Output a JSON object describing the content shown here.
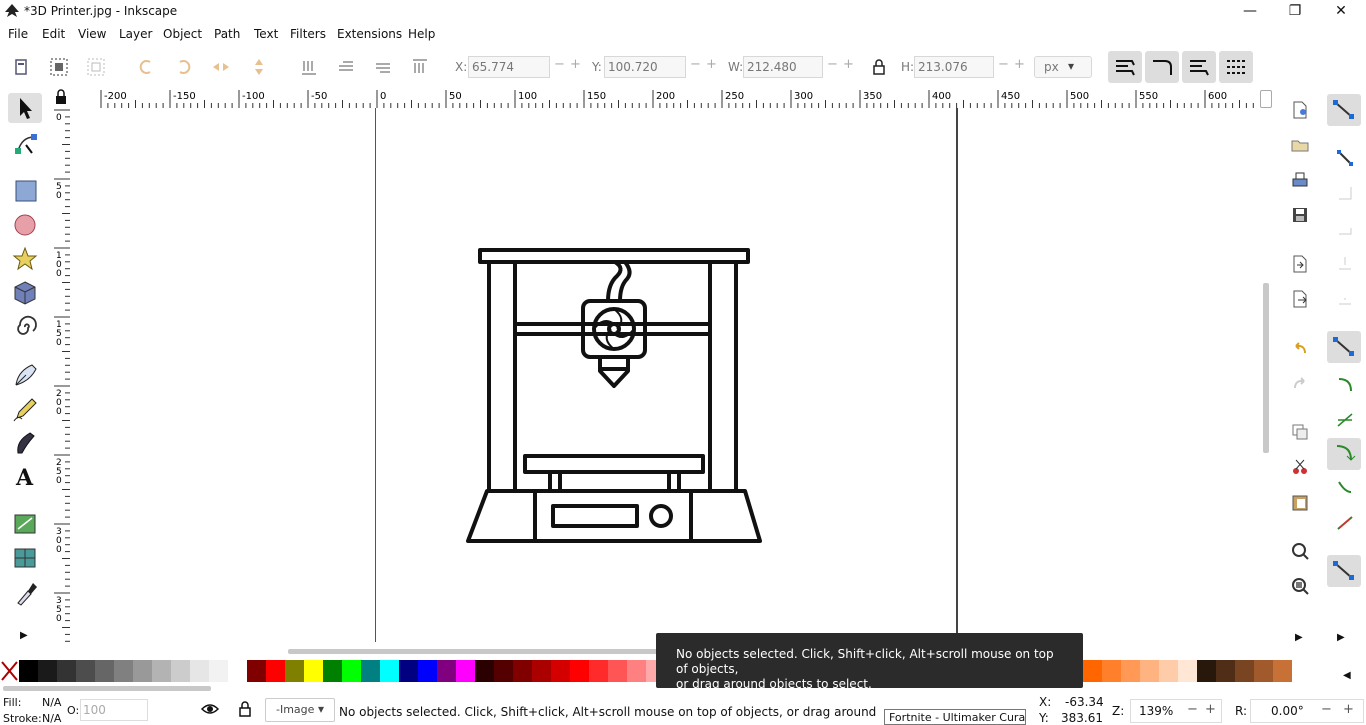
{
  "window": {
    "title": "*3D Printer.jpg - Inkscape",
    "minimize": "—",
    "maximize": "❐",
    "close": "✕"
  },
  "menu": [
    "File",
    "Edit",
    "View",
    "Layer",
    "Object",
    "Path",
    "Text",
    "Filters",
    "Extensions",
    "Help"
  ],
  "toolbar": {
    "x_label": "X:",
    "x_value": "65.774",
    "y_label": "Y:",
    "y_value": "100.720",
    "w_label": "W:",
    "w_value": "212.480",
    "h_label": "H:",
    "h_value": "213.076",
    "unit": "px"
  },
  "ruler": {
    "h_labels": [
      "-200",
      "-150",
      "-100",
      "-50",
      "0",
      "50",
      "100",
      "150",
      "200",
      "250",
      "300",
      "350",
      "400",
      "450",
      "500",
      "550",
      "600"
    ],
    "v_labels": [
      "0",
      "50",
      "100",
      "150",
      "200",
      "250",
      "300",
      "350"
    ]
  },
  "status": {
    "fill_label": "Fill:",
    "fill_value": "N/A",
    "stroke_label": "Stroke:",
    "stroke_value": "N/A",
    "opacity_label": "O:",
    "opacity_value": "100",
    "layer": "-Image",
    "message": "No objects selected. Click, Shift+click, Alt+scroll mouse on top of objects, or drag around objects to select.",
    "x_label": "X:",
    "x_value": "-63.34",
    "y_label": "Y:",
    "y_value": "383.61",
    "z_label": "Z:",
    "zoom": "139%",
    "r_label": "R:",
    "rotation": "0.00°"
  },
  "tooltip": {
    "line1": "No objects selected. Click, Shift+click, Alt+scroll mouse on top of objects,",
    "line2": "or drag around objects to select."
  },
  "taskbar_tooltip": "Fortnite - Ultimaker Cura",
  "palette": [
    "#000000",
    "#1a1a1a",
    "#333333",
    "#4d4d4d",
    "#666666",
    "#808080",
    "#999999",
    "#b3b3b3",
    "#cccccc",
    "#e6e6e6",
    "#f2f2f2",
    "#ffffff",
    "#800000",
    "#ff0000",
    "#808000",
    "#ffff00",
    "#008000",
    "#00ff00",
    "#008080",
    "#00ffff",
    "#000080",
    "#0000ff",
    "#800080",
    "#ff00ff",
    "#2b0000",
    "#550000",
    "#800000",
    "#aa0000",
    "#d40000",
    "#ff0000",
    "#ff2a2a",
    "#ff5555",
    "#ff8080",
    "#ffaaaa",
    "#ffd5d5",
    "#280b0b",
    "#501616",
    "#782121",
    "#a02c2c",
    "#c83737",
    "#d35f5f",
    "#de8787",
    "#e9afaf",
    "#f4d7d7",
    "#241c1c",
    "#483737",
    "#6c5353",
    "#917c6f",
    "#b7a59c",
    "#d3c5bc",
    "#e9ddd6",
    "#2b1100",
    "#552200",
    "#803300",
    "#aa4400",
    "#d45500",
    "#ff6600",
    "#ff7f2a",
    "#ff9955",
    "#ffb380",
    "#ffccaa",
    "#ffe6d5",
    "#28170b",
    "#502d16",
    "#784421",
    "#a05a2c",
    "#c87137"
  ]
}
